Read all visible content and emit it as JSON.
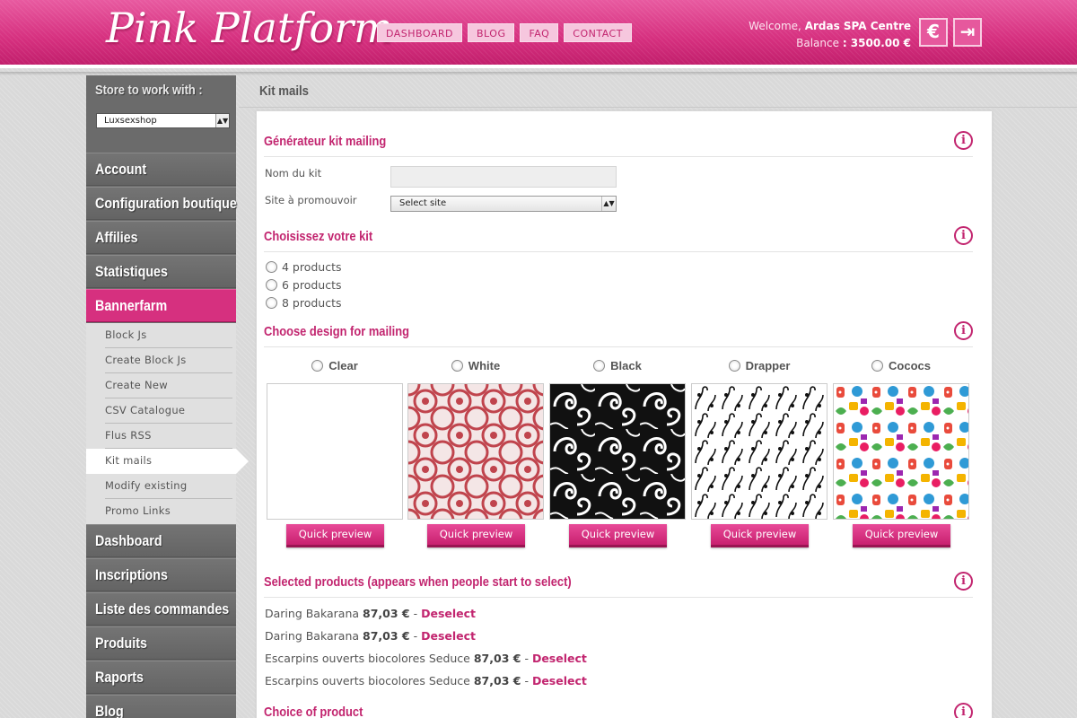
{
  "header": {
    "logo": "Pink Platform",
    "nav": [
      "DASHBOARD",
      "BLOG",
      "FAQ",
      "CONTACT"
    ],
    "welcome_prefix": "Welcome,",
    "user_name": "Ardas SPA Centre",
    "balance_label": "Balance",
    "balance_value": ": 3500.00 €",
    "currency_icon": "€",
    "logout_icon": "⇥"
  },
  "sidebar": {
    "store_label": "Store to work with :",
    "store_value": "Luxsexshop",
    "menu_top": [
      "Account",
      "Configuration boutique",
      "Affilies",
      "Statistiques",
      "Bannerfarm"
    ],
    "submenu": [
      "Block Js",
      "Create Block Js",
      "Create New",
      "CSV Catalogue",
      "Flus RSS",
      "Kit mails",
      "Modify existing",
      "Promo Links"
    ],
    "menu_bottom": [
      "Dashboard",
      "Inscriptions",
      "Liste des commandes",
      "Produits",
      "Raports",
      "Blog"
    ]
  },
  "main": {
    "page_title": "Kit mails",
    "sections": {
      "generator": "Générateur kit mailing",
      "choose_kit": "Choisissez votre kit",
      "choose_design": "Choose design for mailing",
      "selected": "Selected products (appears when people start to select)",
      "choice": "Choice of product"
    },
    "form": {
      "name_label": "Nom du kit",
      "site_label": "Site à promouvoir",
      "site_select_value": "Select site"
    },
    "kit_options": [
      "4 products",
      "6 products",
      "8 products"
    ],
    "designs": [
      "Clear",
      "White",
      "Black",
      "Drapper",
      "Cococs"
    ],
    "quick_preview_label": "Quick preview",
    "selected_products": [
      {
        "name": "Daring Bakarana",
        "price": "87,03 €"
      },
      {
        "name": "Daring Bakarana",
        "price": "87,03 €"
      },
      {
        "name": "Escarpins ouverts biocolores Seduce",
        "price": "87,03 €"
      },
      {
        "name": "Escarpins ouverts biocolores Seduce",
        "price": "87,03 €"
      }
    ],
    "separator": "-",
    "deselect_label": "Deselect",
    "info_icon": "i"
  }
}
